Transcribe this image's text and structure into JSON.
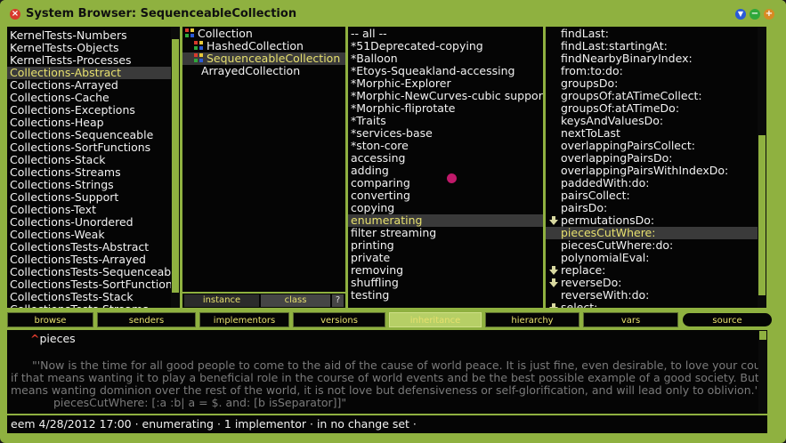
{
  "window": {
    "title": "System Browser: SequenceableCollection"
  },
  "categories": [
    "KernelTests-Numbers",
    "KernelTests-Objects",
    "KernelTests-Processes",
    "Collections-Abstract",
    "Collections-Arrayed",
    "Collections-Cache",
    "Collections-Exceptions",
    "Collections-Heap",
    "Collections-Sequenceable",
    "Collections-SortFunctions",
    "Collections-Stack",
    "Collections-Streams",
    "Collections-Strings",
    "Collections-Support",
    "Collections-Text",
    "Collections-Unordered",
    "Collections-Weak",
    "CollectionsTests-Abstract",
    "CollectionsTests-Arrayed",
    "CollectionsTests-Sequenceable",
    "CollectionsTests-SortFunctions",
    "CollectionsTests-Stack",
    "CollectionsTests-Streams"
  ],
  "selected_category": 3,
  "classes": [
    "Collection",
    "HashedCollection",
    "SequenceableCollection",
    "ArrayedCollection"
  ],
  "selected_class": 2,
  "class_switch": {
    "instance": "instance",
    "class": "class",
    "help": "?"
  },
  "protocols": [
    "-- all --",
    "*51Deprecated-copying",
    "*Balloon",
    "*Etoys-Squeakland-accessing",
    "*Morphic-Explorer",
    "*Morphic-NewCurves-cubic support",
    "*Morphic-fliprotate",
    "*Traits",
    "*services-base",
    "*ston-core",
    "accessing",
    "adding",
    "comparing",
    "converting",
    "copying",
    "enumerating",
    "filter streaming",
    "printing",
    "private",
    "removing",
    "shuffling",
    "testing"
  ],
  "selected_protocol": 15,
  "methods": [
    "findLast:",
    "findLast:startingAt:",
    "findNearbyBinaryIndex:",
    "from:to:do:",
    "groupsDo:",
    "groupsOf:atATimeCollect:",
    "groupsOf:atATimeDo:",
    "keysAndValuesDo:",
    "nextToLast",
    "overlappingPairsCollect:",
    "overlappingPairsDo:",
    "overlappingPairsWithIndexDo:",
    "paddedWith:do:",
    "pairsCollect:",
    "pairsDo:",
    "permutationsDo:",
    "piecesCutWhere:",
    "piecesCutWhere:do:",
    "polynomialEval:",
    "replace:",
    "reverseDo:",
    "reverseWith:do:",
    "select:"
  ],
  "method_arrows": [
    15,
    19,
    20,
    22
  ],
  "selected_method": 16,
  "buttons": [
    "browse",
    "senders",
    "implementors",
    "versions",
    "inheritance",
    "hierarchy",
    "vars",
    "source"
  ],
  "active_button": 4,
  "code": {
    "selector": "pieces",
    "comment_lines": [
      "\"'Now is the time for all good people to come to the aid of the cause of world peace.  It is just fine, even desirable, to love your country,",
      "if that means wanting it to play a beneficial role in the course of world events and be the best possible example of a good society.  But if it",
      "means wanting dominion over the rest of the world, it is not love but defensiveness or self-glorification, and will lead only to oblivion.'"
    ],
    "example_line": "piecesCutWhere: [:a :b| a = $. and: [b isSeparator]]\""
  },
  "status": "eem 4/28/2012 17:00 · enumerating · 1 implementor · in no change set ·",
  "colors": {
    "frame": "#8fb140",
    "selection_text": "#e7e06e",
    "close": "#d83a2c",
    "menu": "#2a5ad8",
    "collapse": "#2fa83a",
    "expand": "#d88a22",
    "cursor_dot": "#c0196a"
  }
}
